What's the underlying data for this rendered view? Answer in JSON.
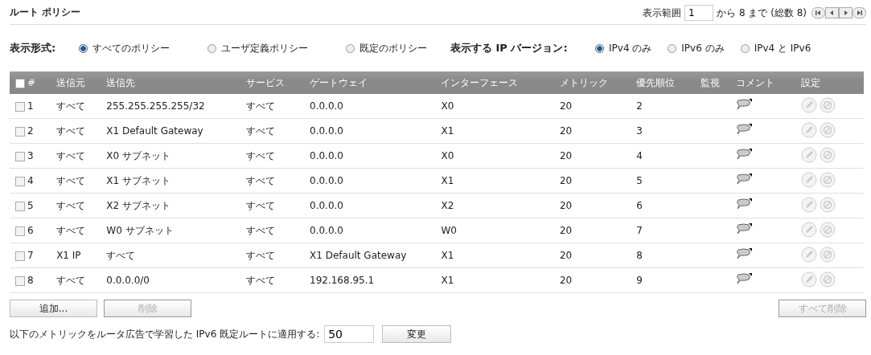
{
  "title": "ルート ポリシー",
  "pager": {
    "label": "表示範囲",
    "value": "1",
    "range_text": "から 8 まで (総数 8)"
  },
  "view_mode": {
    "label": "表示形式:",
    "options": [
      {
        "label": "すべてのポリシー",
        "selected": true
      },
      {
        "label": "ユーザ定義ポリシー",
        "selected": false
      },
      {
        "label": "既定のポリシー",
        "selected": false
      }
    ]
  },
  "ip_version": {
    "label": "表示する IP バージョン:",
    "options": [
      {
        "label": "IPv4 のみ",
        "selected": true
      },
      {
        "label": "IPv6 のみ",
        "selected": false
      },
      {
        "label": "IPv4 と IPv6",
        "selected": false
      }
    ]
  },
  "table": {
    "all_checked": false,
    "columns": [
      "#",
      "送信元",
      "送信先",
      "サービス",
      "ゲートウェイ",
      "インターフェース",
      "メトリック",
      "優先順位",
      "監視",
      "コメント",
      "設定"
    ],
    "rows": [
      {
        "checked": false,
        "actions_disabled": true,
        "cells": [
          "1",
          "すべて",
          "255.255.255.255/32",
          "すべて",
          "0.0.0.0",
          "X0",
          "20",
          "2"
        ]
      },
      {
        "checked": false,
        "actions_disabled": true,
        "cells": [
          "2",
          "すべて",
          "X1 Default Gateway",
          "すべて",
          "0.0.0.0",
          "X1",
          "20",
          "3"
        ]
      },
      {
        "checked": false,
        "actions_disabled": true,
        "cells": [
          "3",
          "すべて",
          "X0 サブネット",
          "すべて",
          "0.0.0.0",
          "X0",
          "20",
          "4"
        ]
      },
      {
        "checked": false,
        "actions_disabled": true,
        "cells": [
          "4",
          "すべて",
          "X1 サブネット",
          "すべて",
          "0.0.0.0",
          "X1",
          "20",
          "5"
        ]
      },
      {
        "checked": false,
        "actions_disabled": true,
        "cells": [
          "5",
          "すべて",
          "X2 サブネット",
          "すべて",
          "0.0.0.0",
          "X2",
          "20",
          "6"
        ]
      },
      {
        "checked": false,
        "actions_disabled": true,
        "cells": [
          "6",
          "すべて",
          "W0 サブネット",
          "すべて",
          "0.0.0.0",
          "W0",
          "20",
          "7"
        ]
      },
      {
        "checked": false,
        "actions_disabled": true,
        "cells": [
          "7",
          "X1 IP",
          "すべて",
          "すべて",
          "X1 Default Gateway",
          "X1",
          "20",
          "8"
        ]
      },
      {
        "checked": false,
        "actions_disabled": true,
        "cells": [
          "8",
          "すべて",
          "0.0.0.0/0",
          "すべて",
          "192.168.95.1",
          "X1",
          "20",
          "9"
        ]
      }
    ]
  },
  "buttons": [
    {
      "label": "追加...",
      "disabled": false
    },
    {
      "label": "削除",
      "disabled": true
    },
    {
      "label": "すべて削除",
      "disabled": true
    }
  ],
  "metric_setting": {
    "label": "以下のメトリックをルータ広告で学習した IPv6 既定ルートに適用する:",
    "value": "50",
    "button": "変更"
  }
}
